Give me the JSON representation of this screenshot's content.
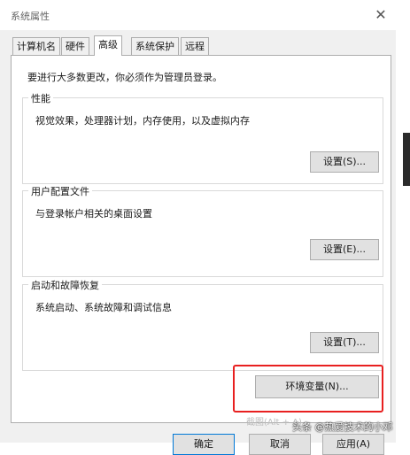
{
  "window": {
    "title": "系统属性"
  },
  "tabs": [
    {
      "label": "计算机名"
    },
    {
      "label": "硬件"
    },
    {
      "label": "高级"
    },
    {
      "label": "系统保护"
    },
    {
      "label": "远程"
    }
  ],
  "advanced": {
    "admin_note": "要进行大多数更改，你必须作为管理员登录。",
    "performance": {
      "title": "性能",
      "desc": "视觉效果，处理器计划，内存使用，以及虚拟内存",
      "button": "设置(S)..."
    },
    "user_profiles": {
      "title": "用户配置文件",
      "desc": "与登录帐户相关的桌面设置",
      "button": "设置(E)..."
    },
    "startup_recovery": {
      "title": "启动和故障恢复",
      "desc": "系统启动、系统故障和调试信息",
      "button": "设置(T)..."
    },
    "env_vars_button": "环境变量(N)...",
    "faded_text": "截图(Alt + A)"
  },
  "footer": {
    "ok": "确定",
    "cancel": "取消",
    "apply": "应用(A)"
  },
  "watermark": "头条 @热爱技术的小邓",
  "colors": {
    "highlight": "#e82020",
    "window_bg": "#f0f0f0"
  }
}
